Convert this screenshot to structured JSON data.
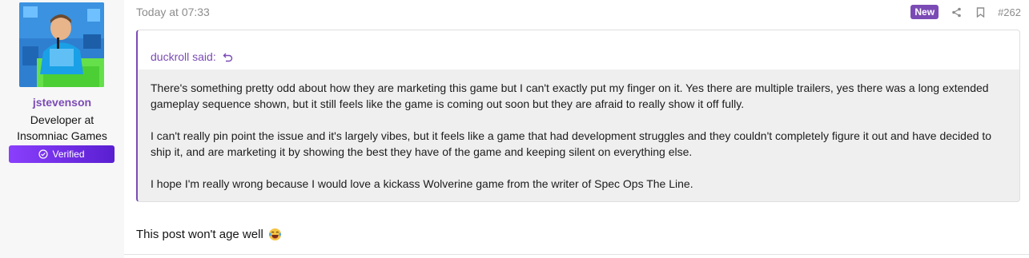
{
  "user": {
    "name": "jstevenson",
    "title_line1": "Developer at",
    "title_line2": "Insomniac Games",
    "verified_label": "Verified"
  },
  "post": {
    "timestamp": "Today at 07:33",
    "new_badge": "New",
    "number": "#262",
    "reply_text": "This post won't age well"
  },
  "quote": {
    "author_said": "duckroll said:",
    "paragraphs": [
      "There's something pretty odd about how they are marketing this game but I can't exactly put my finger on it. Yes there are multiple trailers, yes there was a long extended gameplay sequence shown, but it still feels like the game is coming out soon but they are afraid to really show it off fully.",
      "I can't really pin point the issue and it's largely vibes, but it feels like a game that had development struggles and they couldn't completely figure it out and have decided to ship it, and are marketing it by showing the best they have of the game and keeping silent on everything else.",
      "I hope I'm really wrong because I would love a kickass Wolverine game from the writer of Spec Ops The Line."
    ]
  },
  "icons": {
    "share": "share-icon",
    "bookmark": "bookmark-icon",
    "reply_arrow": "return-arrow-icon",
    "verified": "check-circle-icon",
    "reaction": "laughing-crying-emoji-icon"
  },
  "colors": {
    "accent": "#7b4bb5",
    "verified_gradient_start": "#8a3ffc",
    "verified_gradient_end": "#5a1fd1",
    "quote_bg": "#efefef"
  }
}
